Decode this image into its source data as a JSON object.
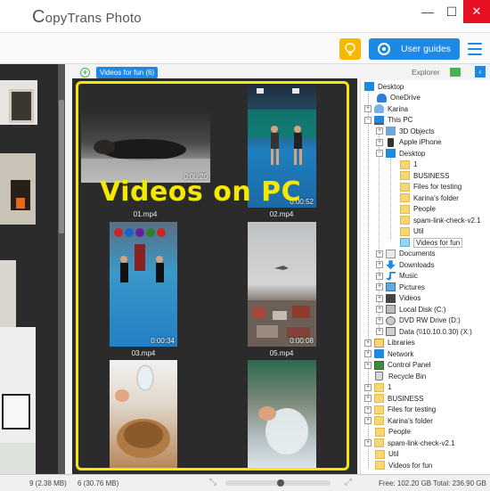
{
  "app": {
    "title": "CopyTrans Photo",
    "logo_letter": "C",
    "logo_rest": "opyTrans Photo"
  },
  "window_controls": {
    "minimize": "—",
    "maximize": "☐",
    "close": "✕"
  },
  "toolbar": {
    "guides_label": "User guides",
    "bulb_icon": "lightbulb-icon",
    "menu_icon": "hamburger-menu-icon"
  },
  "center": {
    "album_tab": "Videos for fun (6)",
    "overlay_text": "Videos on PC",
    "videos": [
      {
        "name": "01.mp4",
        "duration": "0:00:20"
      },
      {
        "name": "02.mp4",
        "duration": "0:00:52"
      },
      {
        "name": "03.mp4",
        "duration": "0:00:34"
      },
      {
        "name": "05.mp4",
        "duration": "0:00:08"
      },
      {
        "name": "",
        "duration": ""
      },
      {
        "name": "",
        "duration": ""
      }
    ]
  },
  "right": {
    "explorer_label": "Explorer",
    "collapse_icon": "‹",
    "tree": [
      {
        "label": "Desktop",
        "icon": "desktop-icon"
      },
      {
        "label": "OneDrive",
        "icon": "cloud-icon"
      },
      {
        "label": "Karina",
        "icon": "user-icon"
      },
      {
        "label": "This PC",
        "icon": "pc-icon"
      },
      {
        "label": "3D Objects",
        "icon": "3d-icon"
      },
      {
        "label": "Apple iPhone",
        "icon": "phone-icon"
      },
      {
        "label": "Desktop",
        "icon": "desktop-icon"
      },
      {
        "label": "1",
        "icon": "folder-icon"
      },
      {
        "label": "BUSINESS",
        "icon": "folder-icon"
      },
      {
        "label": "Files for testing",
        "icon": "folder-icon"
      },
      {
        "label": "Karina's folder",
        "icon": "folder-icon"
      },
      {
        "label": "People",
        "icon": "folder-icon"
      },
      {
        "label": "spam-link-check-v2.1",
        "icon": "folder-icon"
      },
      {
        "label": "Util",
        "icon": "folder-icon"
      },
      {
        "label": "Videos for fun",
        "icon": "folder-icon"
      },
      {
        "label": "Documents",
        "icon": "documents-icon"
      },
      {
        "label": "Downloads",
        "icon": "downloads-icon"
      },
      {
        "label": "Music",
        "icon": "music-icon"
      },
      {
        "label": "Pictures",
        "icon": "pictures-icon"
      },
      {
        "label": "Videos",
        "icon": "videos-icon"
      },
      {
        "label": "Local Disk (C:)",
        "icon": "disk-icon"
      },
      {
        "label": "DVD RW Drive (D:)",
        "icon": "dvd-icon"
      },
      {
        "label": "Data (\\\\10.10.0.30) (X:)",
        "icon": "network-drive-icon"
      },
      {
        "label": "Libraries",
        "icon": "libraries-icon"
      },
      {
        "label": "Network",
        "icon": "network-icon"
      },
      {
        "label": "Control Panel",
        "icon": "control-panel-icon"
      },
      {
        "label": "Recycle Bin",
        "icon": "recycle-bin-icon"
      },
      {
        "label": "1",
        "icon": "folder-icon"
      },
      {
        "label": "BUSINESS",
        "icon": "folder-icon"
      },
      {
        "label": "Files for testing",
        "icon": "folder-icon"
      },
      {
        "label": "Karina's folder",
        "icon": "folder-icon"
      },
      {
        "label": "People",
        "icon": "folder-icon"
      },
      {
        "label": "spam-link-check-v2.1",
        "icon": "folder-icon"
      },
      {
        "label": "Util",
        "icon": "folder-icon"
      },
      {
        "label": "Videos for fun",
        "icon": "folder-icon"
      }
    ]
  },
  "status": {
    "left": "9 (2.38 MB)",
    "center": "6 (30.76 MB)",
    "right": "Free: 102.20 GB Total: 236.90 GB"
  }
}
